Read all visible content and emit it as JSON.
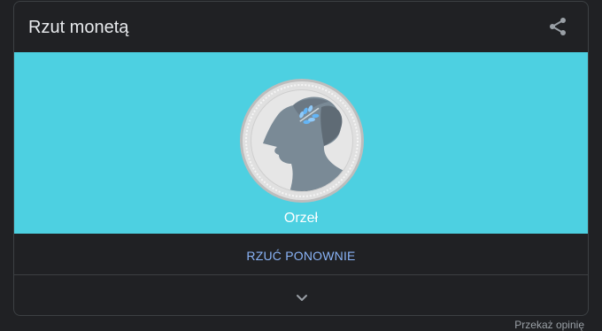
{
  "widget": {
    "title": "Rzut monetą",
    "share_icon": "share-icon",
    "result_label": "Orzeł",
    "coin_side": "heads",
    "retry_label": "RZUĆ PONOWNIE",
    "expand_icon": "chevron-down-icon",
    "feedback_label": "Przekaż opinię"
  },
  "colors": {
    "stage_background": "#4dd0e1",
    "card_background": "#202124",
    "accent": "#8ab4f8",
    "title_text": "#e8eaed"
  }
}
